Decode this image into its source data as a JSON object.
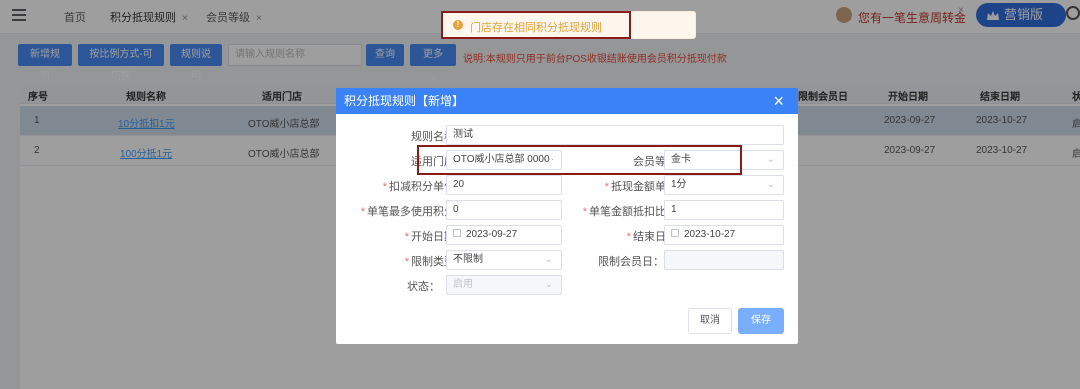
{
  "topbar": {
    "tabs": [
      {
        "label": "首页",
        "closable": false
      },
      {
        "label": "积分抵现规则",
        "closable": true
      },
      {
        "label": "会员等级",
        "closable": true
      }
    ],
    "store_name": "您有一笔生意周转金",
    "store_close": "×",
    "version_label": "营销版"
  },
  "toast": {
    "icon": "warning-icon",
    "message": "门店存在相同积分抵现规则"
  },
  "toolbar": {
    "buttons": [
      "新增规则",
      "按比例方式-可切换",
      "规则说明"
    ],
    "search_placeholder": "请输入规则名称",
    "query_label": "查询",
    "more_label": "更多",
    "note": "说明:本规则只用于前台POS收银结账使用会员积分抵现付款"
  },
  "table": {
    "headers": [
      "序号",
      "规则名称",
      "适用门店",
      "限制会员日",
      "开始日期",
      "结束日期",
      "状"
    ],
    "rows": [
      {
        "index": "1",
        "name": "10分抵扣1元",
        "store": "OTO威小店总部",
        "start": "2023-09-27",
        "end": "2023-10-27",
        "status": "启"
      },
      {
        "index": "2",
        "name": "100分抵1元",
        "store": "OTO威小店总部",
        "start": "2023-09-27",
        "end": "2023-10-27",
        "status": "启"
      }
    ]
  },
  "dialog": {
    "title": "积分抵现规则【新增】",
    "close": "×",
    "fields": {
      "rule_name": {
        "label": "规则名称：",
        "value": "测试"
      },
      "store": {
        "label": "适用门店：",
        "value": "OTO威小店总部  0000"
      },
      "member_level": {
        "label": "会员等级：",
        "value": "金卡"
      },
      "deduct_unit": {
        "label": "扣减积分单位：",
        "value": "20"
      },
      "cash_unit": {
        "label": "抵现金额单位：",
        "value": "1分"
      },
      "max_points": {
        "label": "单笔最多使用积分：",
        "value": "0"
      },
      "max_ratio": {
        "label": "单笔金额抵扣比例：",
        "value": "1"
      },
      "start_date": {
        "label": "开始日期：",
        "value": "2023-09-27"
      },
      "end_date": {
        "label": "结束日期：",
        "value": "2023-10-27"
      },
      "limit_type": {
        "label": "限制类型：",
        "value": "不限制"
      },
      "member_day": {
        "label": "限制会员日：",
        "value": ""
      },
      "status": {
        "label": "状态：",
        "value": "启用"
      }
    },
    "cancel_label": "取消",
    "save_label": "保存"
  },
  "colors": {
    "primary": "#3b82f6",
    "warning": "#e6a23c",
    "danger_note": "#e74c3c",
    "highlight_box": "#8b1a1a"
  }
}
